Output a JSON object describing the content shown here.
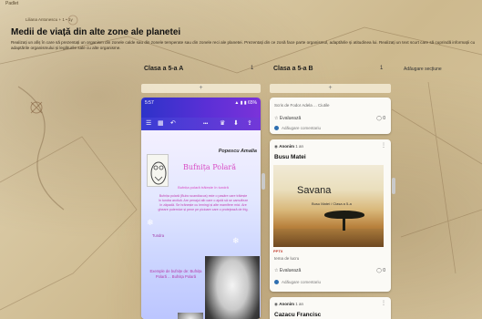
{
  "window": {
    "topbar": "Padlet"
  },
  "header": {
    "author": "Liliana Antonescu + 1 • 1y",
    "title": "Medii de viață din alte zone ale planetei",
    "description": "Realizați un afiș în care să prezentați un organism din zonele calde sau din zonele temperate sau din zonele reci ale planetei. Prezentați din ce zonă face parte organismul, adaptările și atitudinea lui. Realizați un text scurt care să cuprindă informații cu adaptările organismului și legăturile sale cu alte organisme.",
    "add_section": "Adăugare secțiune"
  },
  "columns": [
    {
      "name": "Clasa a 5-a A",
      "count": "1",
      "add": "+"
    },
    {
      "name": "Clasa a 5-a B",
      "count": "1",
      "add": "+"
    }
  ],
  "card_a": {
    "status_time": "5:57",
    "status_right": "▲ ▮ ▮ 65%",
    "toolbar_icons": [
      "menu-icon",
      "grid-icon",
      "undo-icon",
      "more-icon",
      "crown-icon",
      "download-icon",
      "share-icon"
    ],
    "toolbar_glyphs": [
      "☰",
      "▦",
      "↶",
      "•••",
      "♛",
      "⬇",
      "⇪"
    ],
    "poster_name": "Popescu Amalia",
    "poster_title": "Bufnița Polară",
    "poster_subtitle": "Bufnița polară trăiește în tundră",
    "poster_text": "Bufnița polară (Bubo scandiacus) este o pasăre care trăiește în tundra arctică. Are penajul alb care o ajută să se camufleze în zăpadă. Se hrănește cu lemingi și alte mamifere mici. Are gheare puternice și pene pe picioare care o protejează de frig.",
    "poster_small": "Tundra",
    "poster_bottom": "Exemple de bufnițe de: Bufnița Polară ... Bufnița Polară"
  },
  "card_b_top": {
    "line": "Scris de Fodor Adela ... Ciutile",
    "bookmark": "Evaluează",
    "comments": "Adăugare comentariu",
    "count": "0"
  },
  "card_b": {
    "author": "Anonim",
    "time": "1 an",
    "title": "Busu Matei",
    "image_word": "Savana",
    "image_sub": "Busu Matei / Clasa a 5-a",
    "ppt_tag": "PPTX",
    "caption": "tema de lucru",
    "bookmark": "Evaluează",
    "comments": "Adăugare comentariu",
    "count": "0"
  },
  "card_c": {
    "author": "Anonim",
    "time": "1 an",
    "title": "Cazacu Francisc"
  }
}
